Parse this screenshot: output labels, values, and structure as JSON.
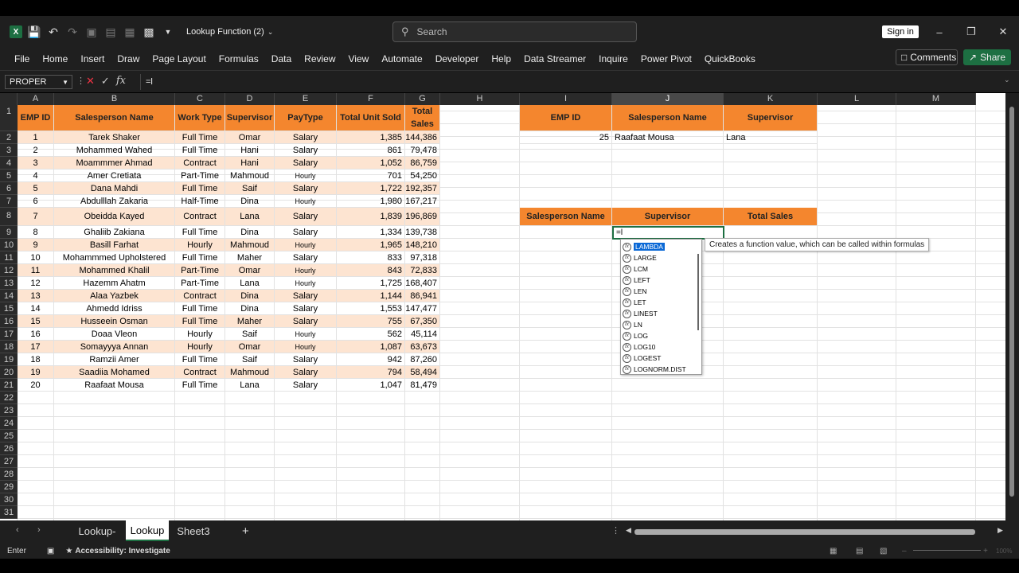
{
  "titlebar": {
    "doc_title": "Lookup Function (2)",
    "search_placeholder": "Search",
    "signin": "Sign in"
  },
  "ribbon": {
    "tabs": [
      "File",
      "Home",
      "Insert",
      "Draw",
      "Page Layout",
      "Formulas",
      "Data",
      "Review",
      "View",
      "Automate",
      "Developer",
      "Help",
      "Data Streamer",
      "Inquire",
      "Power Pivot",
      "QuickBooks"
    ],
    "comments": "Comments",
    "share": "Share"
  },
  "formula_bar": {
    "name_box": "PROPER",
    "formula": "=l"
  },
  "columns": [
    "A",
    "B",
    "C",
    "D",
    "E",
    "F",
    "G",
    "H",
    "I",
    "J",
    "K",
    "L",
    "M"
  ],
  "rows": [
    "1",
    "2",
    "3",
    "4",
    "5",
    "6",
    "7",
    "8",
    "9",
    "10",
    "11",
    "12",
    "13",
    "14",
    "15",
    "16",
    "17",
    "18",
    "19",
    "20",
    "21",
    "22",
    "23",
    "24",
    "25",
    "26",
    "27",
    "28",
    "29",
    "30",
    "31"
  ],
  "main_table": {
    "headers": [
      "EMP ID",
      "Salesperson Name",
      "Work Type",
      "Supervisor",
      "PayType",
      "Total Unit Sold",
      "Total Sales"
    ],
    "rows": [
      [
        "1",
        "Tarek Shaker",
        "Full Time",
        "Omar",
        "Salary",
        "1,385",
        "144,386"
      ],
      [
        "2",
        "Mohammed Wahed",
        "Full Time",
        "Hani",
        "Salary",
        "861",
        "79,478"
      ],
      [
        "3",
        "Moammmer Ahmad",
        "Contract",
        "Hani",
        "Salary",
        "1,052",
        "86,759"
      ],
      [
        "4",
        "Amer Cretiata",
        "Part-Time",
        "Mahmoud",
        "Hourly",
        "701",
        "54,250"
      ],
      [
        "5",
        "Dana Mahdi",
        "Full Time",
        "Saif",
        "Salary",
        "1,722",
        "192,357"
      ],
      [
        "6",
        "Abdulllah Zakaria",
        "Half-Time",
        "Dina",
        "Hourly",
        "1,980",
        "167,217"
      ],
      [
        "7",
        "Obeidda Kayed",
        "Contract",
        "Lana",
        "Salary",
        "1,839",
        "196,869"
      ],
      [
        "8",
        "Ghaliib Zakiana",
        "Full Time",
        "Dina",
        "Salary",
        "1,334",
        "139,738"
      ],
      [
        "9",
        "Basill Farhat",
        "Hourly",
        "Mahmoud",
        "Hourly",
        "1,965",
        "148,210"
      ],
      [
        "10",
        "Mohammmed Upholstered",
        "Full Time",
        "Maher",
        "Salary",
        "833",
        "97,318"
      ],
      [
        "11",
        "Mohammed Khalil",
        "Part-Time",
        "Omar",
        "Hourly",
        "843",
        "72,833"
      ],
      [
        "12",
        "Hazemm Ahatm",
        "Part-Time",
        "Lana",
        "Hourly",
        "1,725",
        "168,407"
      ],
      [
        "13",
        "Alaa Yazbek",
        "Contract",
        "Dina",
        "Salary",
        "1,144",
        "86,941"
      ],
      [
        "14",
        "Ahmedd Idriss",
        "Full Time",
        "Dina",
        "Salary",
        "1,553",
        "147,477"
      ],
      [
        "15",
        "Husseein Osman",
        "Full Time",
        "Maher",
        "Salary",
        "755",
        "67,350"
      ],
      [
        "16",
        "Doaa Vleon",
        "Hourly",
        "Saif",
        "Hourly",
        "562",
        "45,114"
      ],
      [
        "17",
        "Somayyya Annan",
        "Hourly",
        "Omar",
        "Hourly",
        "1,087",
        "63,673"
      ],
      [
        "18",
        "Ramzii Amer",
        "Full Time",
        "Saif",
        "Salary",
        "942",
        "87,260"
      ],
      [
        "19",
        "Saadiia Mohamed",
        "Contract",
        "Mahmoud",
        "Salary",
        "794",
        "58,494"
      ],
      [
        "20",
        "Raafaat Mousa",
        "Full Time",
        "Lana",
        "Salary",
        "1,047",
        "81,479"
      ]
    ]
  },
  "lookup1": {
    "headers": [
      "EMP ID",
      "Salesperson Name",
      "Supervisor"
    ],
    "values": [
      "25",
      "Raafaat Mousa",
      "Lana"
    ]
  },
  "lookup2": {
    "headers": [
      "Salesperson Name",
      "Supervisor",
      "Total  Sales"
    ]
  },
  "active_cell": {
    "value": "=l"
  },
  "autocomplete": {
    "items": [
      "LAMBDA",
      "LARGE",
      "LCM",
      "LEFT",
      "LEN",
      "LET",
      "LINEST",
      "LN",
      "LOG",
      "LOG10",
      "LOGEST",
      "LOGNORM.DIST"
    ],
    "tooltip": "Creates a function value, which can be called within formulas"
  },
  "sheets": [
    "Lookup-",
    "Lookup",
    "Sheet3"
  ],
  "status": {
    "mode": "Enter",
    "accessibility": "Accessibility: Investigate",
    "zoom": "100%"
  }
}
